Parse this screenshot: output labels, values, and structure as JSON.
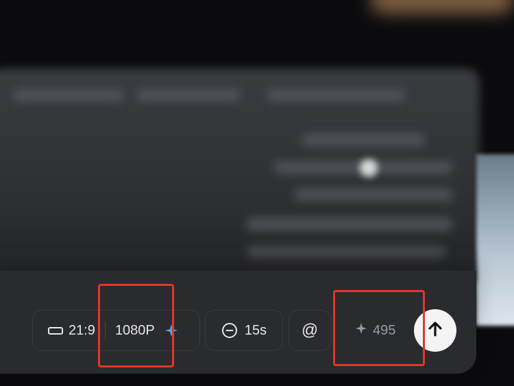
{
  "toolbar": {
    "aspect_ratio": "21:9",
    "resolution": "1080P",
    "duration": "15s",
    "mention_symbol": "@",
    "credits": "495"
  },
  "icons": {
    "aspect_ratio": "aspect-ratio-icon",
    "resolution_premium": "sparkle-icon",
    "duration": "minus-circle-icon",
    "credits": "sparkle-icon",
    "send": "arrow-up-icon"
  },
  "colors": {
    "highlight": "#e2362a",
    "accent_sparkle": "#4aa8e6",
    "send_button": "#f4f4f5"
  }
}
